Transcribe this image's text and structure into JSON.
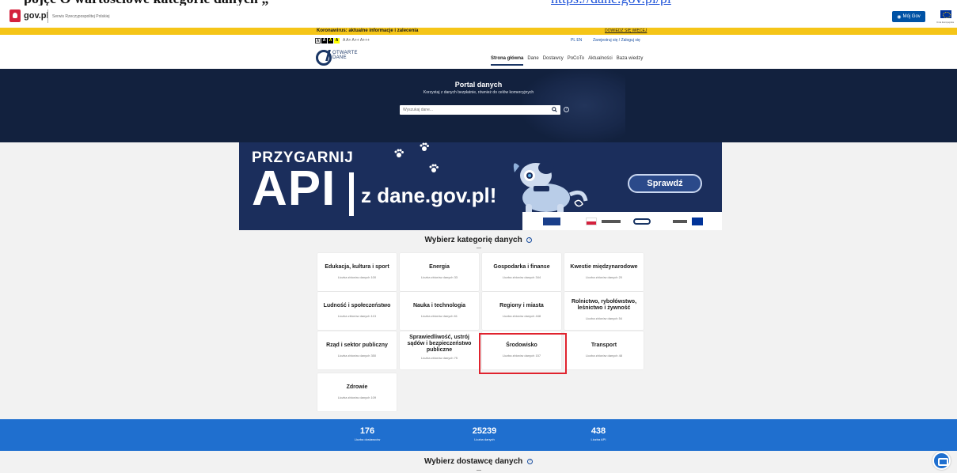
{
  "doc_caption": {
    "text": "pojęć Ó wartościowe kategorie danych „",
    "link": "https://dane.gov.pl/pl"
  },
  "gov_bar": {
    "logo_text": "gov.pl",
    "service_text": "Serwis Rzeczypospolitej Polskiej",
    "mojgov_label": "Mój Gov",
    "eu_caption": "Unia Europejska"
  },
  "alert": {
    "text": "Koronawirus: aktualne informacje i zalecenia",
    "link": "DOWIEDZ SIĘ WIĘCEJ"
  },
  "header": {
    "contrast_options": [
      "A",
      "A",
      "A",
      "A"
    ],
    "font_sizes": "A  A+  A++  A+++",
    "lang": "PL  EN",
    "register": "Zarejestruj się",
    "login": "Zaloguj się",
    "logo_line1": "OTWARTE",
    "logo_line2": "DANE",
    "nav": [
      "Strona główna",
      "Dane",
      "Dostawcy",
      "PoCoTo",
      "Aktualności",
      "Baza wiedzy"
    ]
  },
  "hero": {
    "title": "Portal danych",
    "subtitle": "Korzystaj z danych bezpłatnie, również do celów komercyjnych",
    "search_placeholder": "Wyszukaj dane...",
    "help": "?"
  },
  "banner": {
    "title": "PRZYGARNIJ",
    "api": "API",
    "domain": "z dane.gov.pl!",
    "cta": "Sprawdź",
    "colors": {
      "bg": "#1b2e5c",
      "cta_bg": "#2b4a8a"
    }
  },
  "categories": {
    "heading": "Wybierz kategorię danych",
    "help": "?",
    "tiles": [
      {
        "name": "Edukacja, kultura i sport",
        "count": "Liczba zbiorów danych 100"
      },
      {
        "name": "Energia",
        "count": "Liczba zbiorów danych 33"
      },
      {
        "name": "Gospodarka i finanse",
        "count": "Liczba zbiorów danych 344"
      },
      {
        "name": "Kwestie międzynarodowe",
        "count": "Liczba zbiorów danych 20"
      },
      {
        "name": "Ludność i społeczeństwo",
        "count": "Liczba zbiorów danych 113"
      },
      {
        "name": "Nauka i technologia",
        "count": "Liczba zbiorów danych 61"
      },
      {
        "name": "Regiony i miasta",
        "count": "Liczba zbiorów danych 448"
      },
      {
        "name": "Rolnictwo, rybołówstwo, leśnictwo i żywność",
        "count": "Liczba zbiorów danych 54"
      },
      {
        "name": "Rząd i sektor publiczny",
        "count": "Liczba zbiorów danych 350"
      },
      {
        "name": "Sprawiedliwość, ustrój sądów i bezpieczeństwo publiczne",
        "count": "Liczba zbiorów danych 75"
      },
      {
        "name": "Środowisko",
        "count": "Liczba zbiorów danych 157"
      },
      {
        "name": "Transport",
        "count": "Liczba zbiorów danych 48"
      },
      {
        "name": "Zdrowie",
        "count": "Liczba zbiorów danych 109"
      }
    ]
  },
  "stats": [
    {
      "value": "176",
      "label": "Liczba dostawców"
    },
    {
      "value": "25239",
      "label": "Liczba danych"
    },
    {
      "value": "438",
      "label": "Liczba API"
    }
  ],
  "providers": {
    "heading": "Wybierz dostawcę danych",
    "help": "?"
  }
}
